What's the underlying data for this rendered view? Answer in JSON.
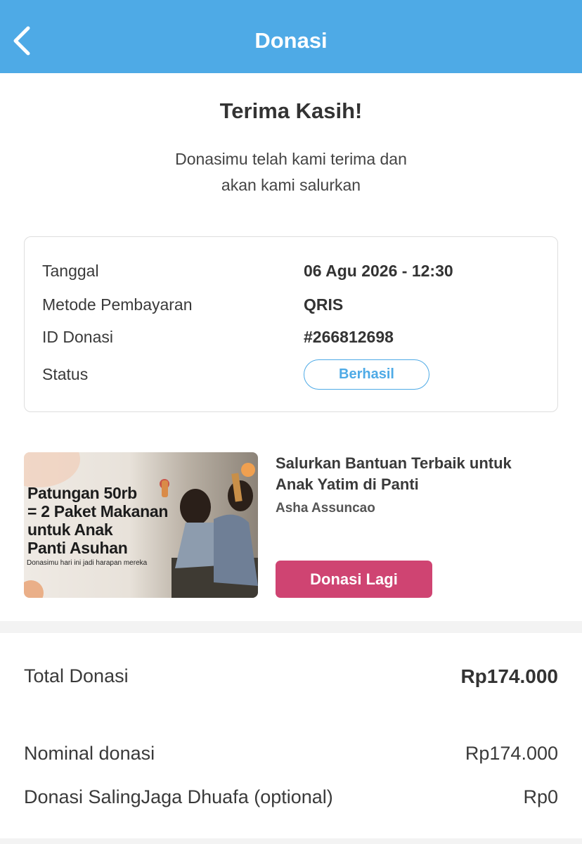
{
  "header": {
    "title": "Donasi",
    "back_icon": "chevron-left-icon",
    "bg_color": "#4eaae6"
  },
  "thanks": {
    "title": "Terima Kasih!",
    "subtitle_line1": "Donasimu telah kami terima dan",
    "subtitle_line2": "akan kami salurkan"
  },
  "details": {
    "rows": [
      {
        "label": "Tanggal",
        "value": "06 Agu 2026 - 12:30"
      },
      {
        "label": "Metode Pembayaran",
        "value": "QRIS"
      },
      {
        "label": "ID Donasi",
        "value": "#266812698"
      }
    ],
    "status_label": "Status",
    "status_value": "Berhasil",
    "status_color": "#4eaae6"
  },
  "campaign": {
    "image_headline": [
      "Patungan 50rb",
      "= 2 Paket Makanan",
      "untuk Anak",
      "Panti Asuhan"
    ],
    "image_subtext": "Donasimu hari ini jadi harapan mereka",
    "title_line1": "Salurkan Bantuan Terbaik untuk",
    "title_line2": "Anak Yatim di Panti",
    "author": "Asha Assuncao",
    "button_label": "Donasi Lagi",
    "button_color": "#cf4472"
  },
  "summary": {
    "total_label": "Total Donasi",
    "total_value": "Rp174.000",
    "lines": [
      {
        "label": "Nominal donasi",
        "value": "Rp174.000"
      },
      {
        "label": "Donasi SalingJaga Dhuafa (optional)",
        "value": "Rp0"
      }
    ]
  }
}
